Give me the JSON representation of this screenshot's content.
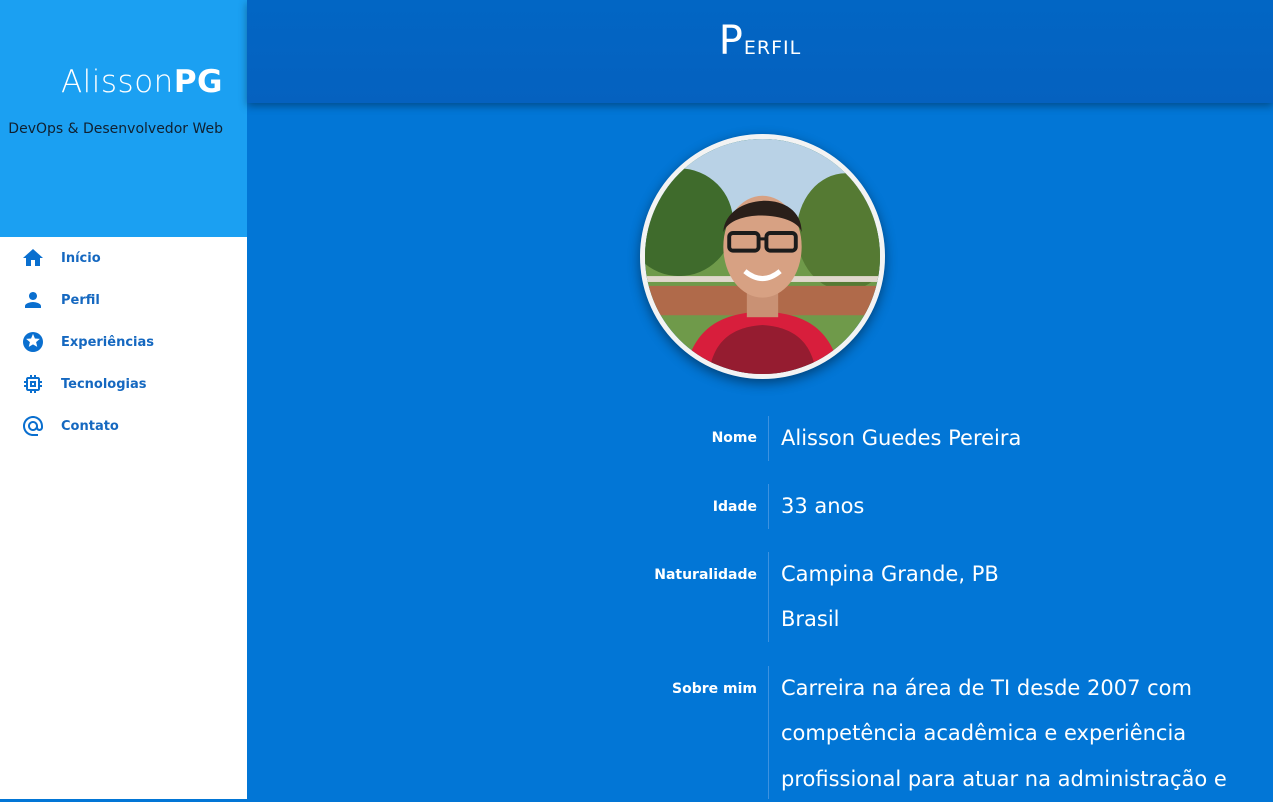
{
  "brand": {
    "name_light": "Alisson",
    "name_bold": "PG",
    "subtitle": "DevOps & Desenvolvedor Web"
  },
  "nav": {
    "items": [
      {
        "label": "Início",
        "icon": "home-icon"
      },
      {
        "label": "Perfil",
        "icon": "person-icon"
      },
      {
        "label": "Experiências",
        "icon": "star-icon"
      },
      {
        "label": "Tecnologias",
        "icon": "chip-icon"
      },
      {
        "label": "Contato",
        "icon": "at-icon"
      }
    ]
  },
  "header": {
    "title": "Perfil"
  },
  "profile": {
    "name_label": "Nome",
    "name_value": "Alisson Guedes Pereira",
    "age_label": "Idade",
    "age_value": "33 anos",
    "birthplace_label": "Naturalidade",
    "birthplace_line1": "Campina Grande, PB",
    "birthplace_line2": "Brasil",
    "about_label": "Sobre mim",
    "about_line1": "Carreira na área de TI desde 2007 com",
    "about_line2": "competência acadêmica e experiência",
    "about_line3": "profissional para atuar na administração e"
  },
  "colors": {
    "accent": "#1ba0f2",
    "main_bg": "#0276d6",
    "header_bg": "#0266c4",
    "nav_text": "#1568c0"
  }
}
